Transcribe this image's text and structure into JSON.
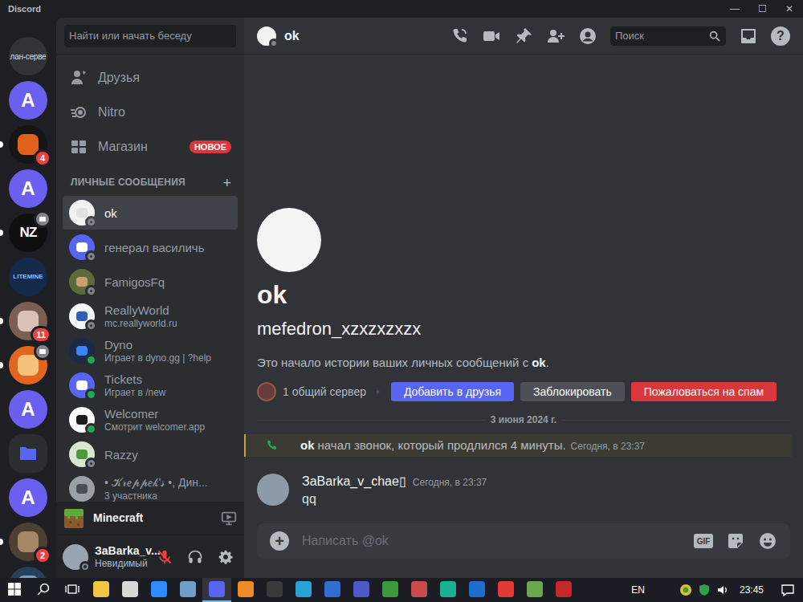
{
  "window": {
    "title": "Discord",
    "controls": [
      "—",
      "☐",
      "✕"
    ]
  },
  "servers": [
    {
      "label": "лан-серве",
      "kind": "short",
      "color": "#313338",
      "unread": false,
      "icon_badge": false
    },
    {
      "label": "A",
      "kind": "letter",
      "color": "#6b5ff0",
      "unread": false,
      "icon_badge": false
    },
    {
      "kind": "image",
      "color": "#161616",
      "accent": "#e0601c",
      "badge": "4",
      "unread": true,
      "icon_badge": false
    },
    {
      "label": "A",
      "kind": "letter",
      "color": "#6b5ff0",
      "unread": false,
      "icon_badge": false
    },
    {
      "label": "NZ",
      "kind": "logo",
      "color": "#0f0f0f",
      "unread": true,
      "icon_badge": true
    },
    {
      "label": "LITEMINE",
      "kind": "tiny",
      "color": "#142a4a",
      "unread": false,
      "icon_badge": false
    },
    {
      "kind": "image",
      "color": "#7a5f52",
      "accent": "#d9c2b5",
      "badge": "11",
      "unread": true,
      "icon_badge": false
    },
    {
      "kind": "image",
      "color": "#e2661f",
      "accent": "#f6c27b",
      "unread": true,
      "icon_badge": true
    },
    {
      "label": "A",
      "kind": "letter",
      "color": "#6b5ff0",
      "unread": false,
      "icon_badge": false
    },
    {
      "kind": "folder",
      "color": "#2b2d31",
      "accent": "#5865f2",
      "unread": false,
      "icon_badge": false
    },
    {
      "label": "A",
      "kind": "letter",
      "color": "#6b5ff0",
      "unread": false,
      "icon_badge": false
    },
    {
      "kind": "image",
      "color": "#4e3f33",
      "accent": "#a58766",
      "badge": "2",
      "unread": true,
      "icon_badge": false
    },
    {
      "kind": "image",
      "color": "#27405e",
      "accent": "#7aa0c8",
      "unread": true,
      "icon_badge": false
    }
  ],
  "sidebar": {
    "search_placeholder": "Найти или начать беседу",
    "nav": [
      {
        "label": "Друзья",
        "kind": "friends",
        "selected": false
      },
      {
        "label": "Nitro",
        "kind": "nitro",
        "selected": false
      },
      {
        "label": "Магазин",
        "kind": "shop",
        "selected": false,
        "badge": "НОВОЕ"
      }
    ],
    "dm_header": "ЛИЧНЫЕ СООБЩЕНИЯ",
    "dm_add": "+",
    "dms": [
      {
        "name": "ok",
        "status": "offline",
        "selected": true,
        "color": "#f2f2f2",
        "accent": "#e2e2e2"
      },
      {
        "name": "генерал василичь",
        "status": "offline",
        "selected": false,
        "color": "#5865f2",
        "accent": "#ffffff"
      },
      {
        "name": "FamigosFq",
        "status": "offline",
        "selected": false,
        "color": "#5b6b3a",
        "accent": "#c9a070"
      },
      {
        "name": "ReallyWorld",
        "subtitle": "mc.reallyworld.ru",
        "status": "offline",
        "selected": false,
        "color": "#f3f6fb",
        "accent": "#2d5fb5"
      },
      {
        "name": "Dyno",
        "subtitle": "Играет в dyno.gg | ?help",
        "status": "online",
        "selected": false,
        "color": "#1c2a4a",
        "accent": "#3b82f6"
      },
      {
        "name": "Tickets",
        "subtitle": "Играет в /new",
        "status": "online",
        "selected": false,
        "color": "#5865f2",
        "accent": "#ffffff"
      },
      {
        "name": "Welcomer",
        "subtitle": "Смотрит welcomer.app",
        "status": "online",
        "selected": false,
        "color": "#ffffff",
        "accent": "#1b1b1b"
      },
      {
        "name": "Razzy",
        "status": "offline",
        "selected": false,
        "color": "#d9e6d0",
        "accent": "#4a9a3a"
      },
      {
        "name": "• 𝒦𝓇𝑒𝓅𝓅𝑒𝓀'𝓈 •, Дин...",
        "subtitle": "3 участника",
        "status": "none",
        "selected": false,
        "color": "#9aa0a6",
        "accent": "#4a4f55"
      }
    ],
    "activity": {
      "game": "Minecraft"
    },
    "user": {
      "name": "ЗаBarka_v...",
      "status_text": "Невидимый",
      "mic_muted": true,
      "deafened": false
    }
  },
  "header": {
    "name": "ok",
    "search_placeholder": "Поиск",
    "help": "?"
  },
  "intro": {
    "display_name": "ok",
    "username": "mefedron_xzxzxzxzx",
    "text": "Это начало истории ваших личных сообщений с",
    "text_name": "ok",
    "text_end": ".",
    "mutual": "1 общий сервер",
    "separator": "•",
    "buttons": [
      {
        "label": "Добавить в друзья",
        "kind": "primary"
      },
      {
        "label": "Заблокировать",
        "kind": "secondary"
      },
      {
        "label": "Пожаловаться на спам",
        "kind": "danger"
      }
    ]
  },
  "date_divider": "3 июня 2024 г.",
  "call": {
    "caller": "ok",
    "text": "начал звонок, который продлился 4 минуты.",
    "time": "Сегодня, в 23:37"
  },
  "messages": [
    {
      "author": "ЗаBarka_v_chae▯",
      "time": "Сегодня, в 23:37",
      "text": "qq"
    }
  ],
  "composer": {
    "add": "+",
    "placeholder": "Написать @ok",
    "gif": "GIF"
  },
  "taskbar": {
    "apps": [
      {
        "kind": "start",
        "active": false
      },
      {
        "kind": "search",
        "active": false
      },
      {
        "kind": "taskview",
        "active": false
      },
      {
        "kind": "app",
        "color": "#f3c545",
        "active": false
      },
      {
        "kind": "app",
        "color": "#d8d8d8",
        "active": false
      },
      {
        "kind": "app",
        "color": "#2d8cff",
        "active": false
      },
      {
        "kind": "app",
        "color": "#6f9fc8",
        "active": false
      },
      {
        "kind": "app",
        "color": "#5865f2",
        "active": true
      },
      {
        "kind": "app",
        "color": "#f08a24",
        "active": false
      },
      {
        "kind": "app",
        "color": "#3a3a3a",
        "active": false
      },
      {
        "kind": "app",
        "color": "#29a3d6",
        "active": false
      },
      {
        "kind": "app",
        "color": "#2f6fd0",
        "active": false
      },
      {
        "kind": "app",
        "color": "#5059c9",
        "active": false
      },
      {
        "kind": "app",
        "color": "#3c9a3c",
        "active": false
      },
      {
        "kind": "app",
        "color": "#c94b4b",
        "active": false
      },
      {
        "kind": "app",
        "color": "#19b28f",
        "active": false
      },
      {
        "kind": "app",
        "color": "#1c6fd1",
        "active": false
      },
      {
        "kind": "app",
        "color": "#e53935",
        "active": false
      },
      {
        "kind": "app",
        "color": "#6aa84f",
        "active": false
      },
      {
        "kind": "app",
        "color": "#c62828",
        "active": false
      }
    ],
    "language": "EN",
    "clock": "23:45"
  }
}
